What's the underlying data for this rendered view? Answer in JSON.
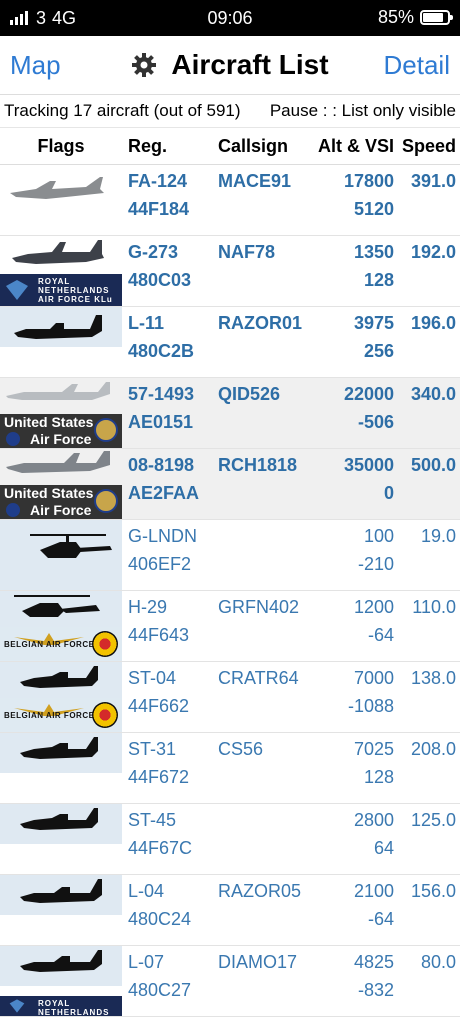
{
  "status_bar": {
    "carrier": "3",
    "network": "4G",
    "time": "09:06",
    "battery": "85%",
    "battery_level": 0.85
  },
  "nav": {
    "left": "Map",
    "title": "Aircraft List",
    "right": "Detail",
    "icon": "gear-icon"
  },
  "info": {
    "tracking": "Tracking 17 aircraft (out of 591)",
    "pause": "Pause : : List only visible"
  },
  "columns": {
    "flags": "Flags",
    "reg": "Reg.",
    "callsign": "Callsign",
    "alt_vsi": "Alt & VSI",
    "speed": "Speed"
  },
  "rows": [
    {
      "reg": "FA-124",
      "hex": "44F184",
      "callsign": "MACE91",
      "alt": "17800",
      "vsi": "5120",
      "speed": "391.0"
    },
    {
      "reg": "G-273",
      "hex": "480C03",
      "callsign": "NAF78",
      "alt": "1350",
      "vsi": "128",
      "speed": "192.0",
      "flag_text": "ROYAL NETHERLANDS AIR FORCE",
      "flag_sub": "KLu"
    },
    {
      "reg": "L-11",
      "hex": "480C2B",
      "callsign": "RAZOR01",
      "alt": "3975",
      "vsi": "256",
      "speed": "196.0"
    },
    {
      "reg": "57-1493",
      "hex": "AE0151",
      "callsign": "QID526",
      "alt": "22000",
      "vsi": "-506",
      "speed": "340.0",
      "flag_text1": "United States",
      "flag_text2": "Air Force"
    },
    {
      "reg": "08-8198",
      "hex": "AE2FAA",
      "callsign": "RCH1818",
      "alt": "35000",
      "vsi": "0",
      "speed": "500.0",
      "flag_text1": "United States",
      "flag_text2": "Air Force"
    },
    {
      "reg": "G-LNDN",
      "hex": "406EF2",
      "callsign": "",
      "alt": "100",
      "vsi": "-210",
      "speed": "19.0"
    },
    {
      "reg": "H-29",
      "hex": "44F643",
      "callsign": "GRFN402",
      "alt": "1200",
      "vsi": "-64",
      "speed": "110.0",
      "flag_text": "BELGIAN AIR FORCE"
    },
    {
      "reg": "ST-04",
      "hex": "44F662",
      "callsign": "CRATR64",
      "alt": "7000",
      "vsi": "-1088",
      "speed": "138.0",
      "flag_text": "BELGIAN AIR FORCE"
    },
    {
      "reg": "ST-31",
      "hex": "44F672",
      "callsign": "CS56",
      "alt": "7025",
      "vsi": "128",
      "speed": "208.0"
    },
    {
      "reg": "ST-45",
      "hex": "44F67C",
      "callsign": "",
      "alt": "2800",
      "vsi": "64",
      "speed": "125.0"
    },
    {
      "reg": "L-04",
      "hex": "480C24",
      "callsign": "RAZOR05",
      "alt": "2100",
      "vsi": "-64",
      "speed": "156.0"
    },
    {
      "reg": "L-07",
      "hex": "480C27",
      "callsign": "DIAMO17",
      "alt": "4825",
      "vsi": "-832",
      "speed": "80.0",
      "flag_text": "ROYAL NETHERLANDS"
    }
  ]
}
